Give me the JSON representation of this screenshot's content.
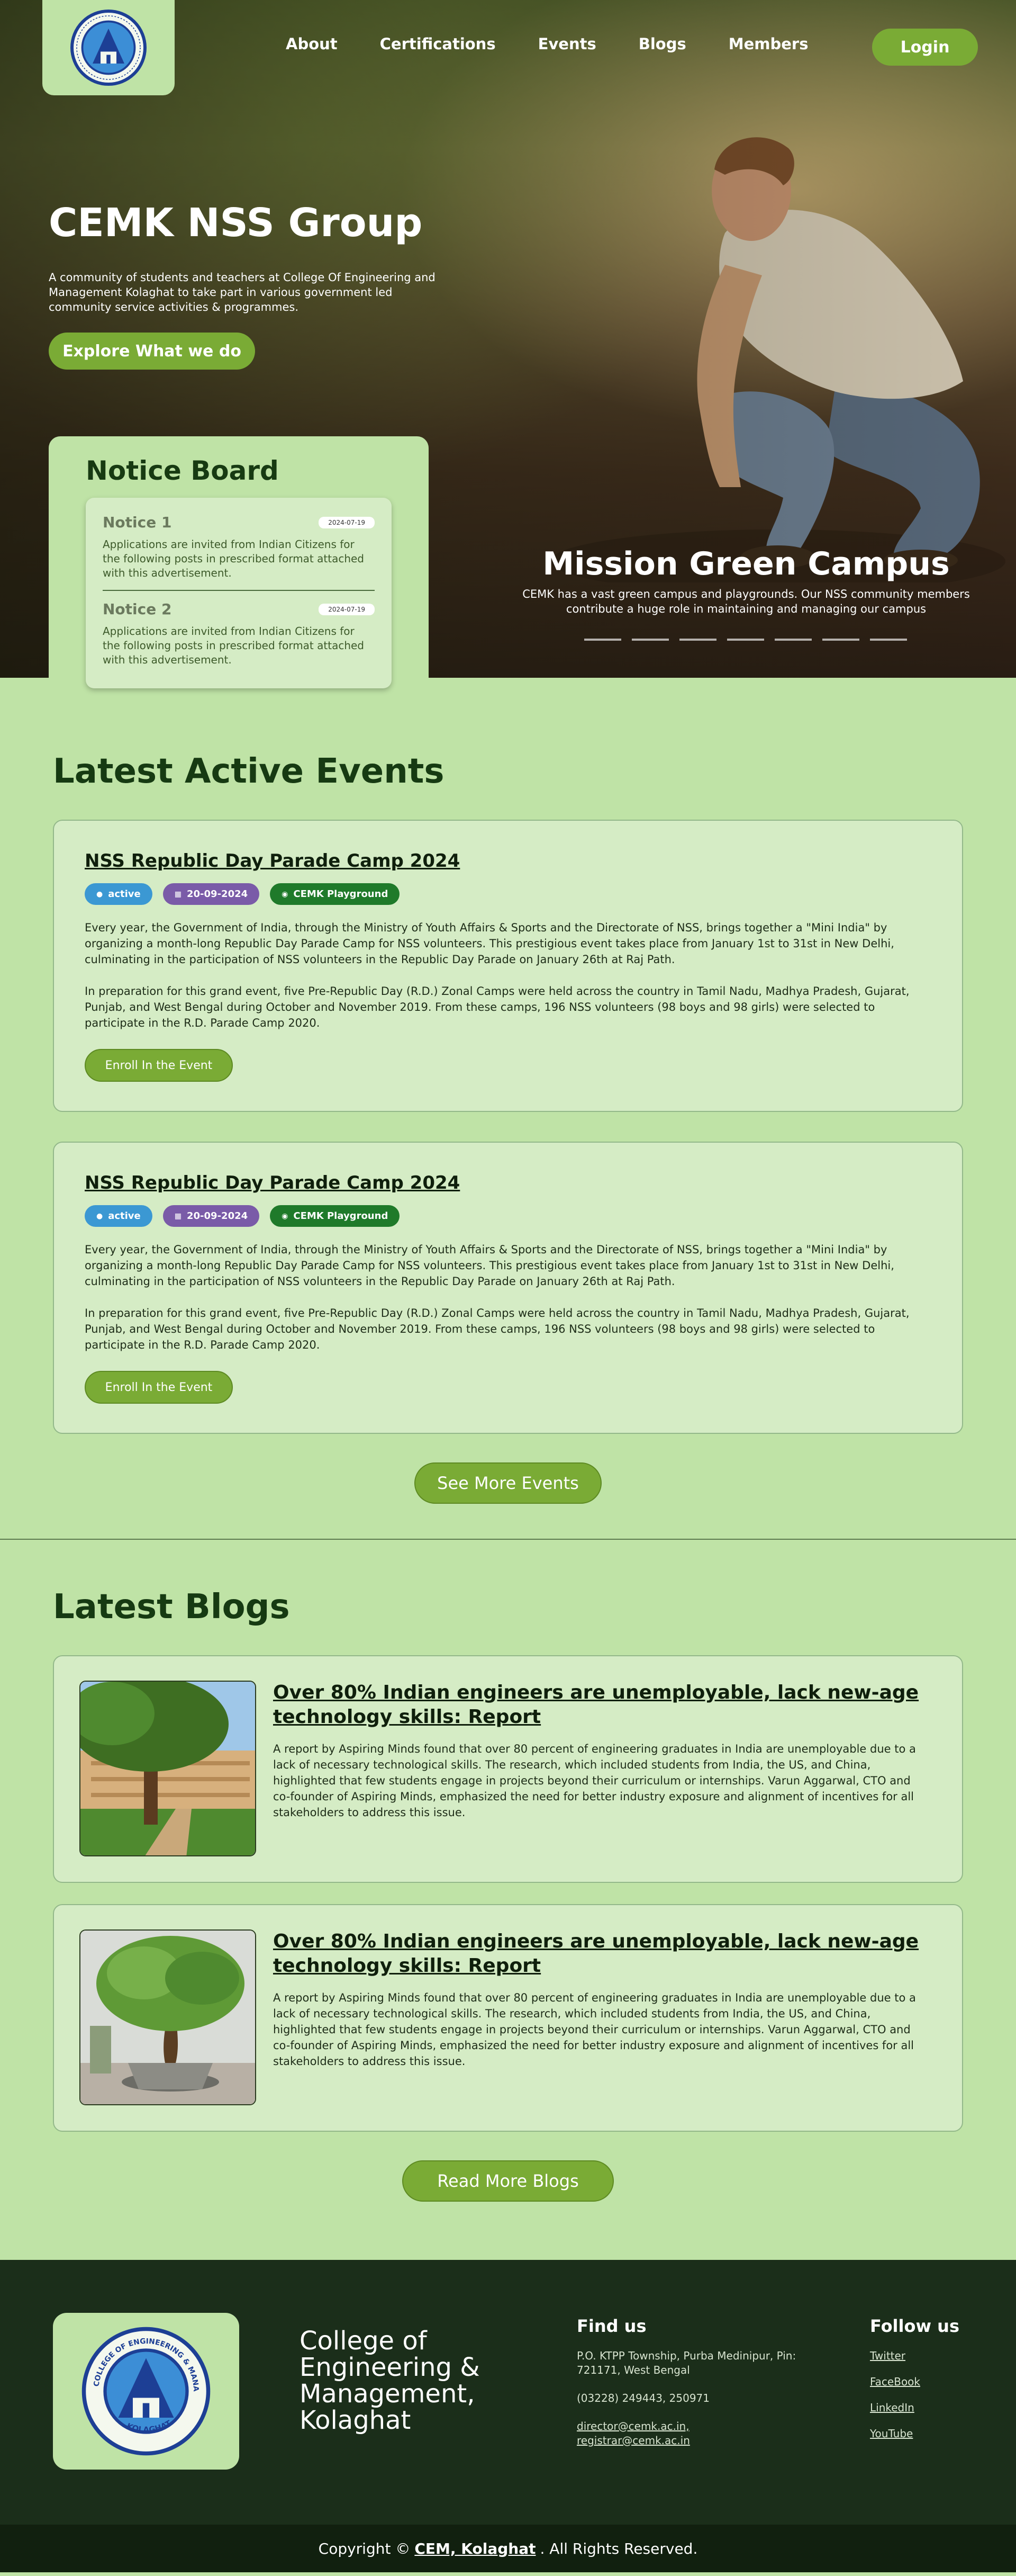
{
  "nav": {
    "items": [
      "About",
      "Certifications",
      "Events",
      "Blogs",
      "Members"
    ],
    "login_label": "Login"
  },
  "hero": {
    "title": "CEMK NSS Group",
    "description": "A community of students and teachers at College Of Engineering and Management Kolaghat to take part in various government led community service activities & programmes.",
    "cta_label": "Explore What we do",
    "slide_title": "Mission Green Campus",
    "slide_text": "CEMK has a vast green campus and playgrounds. Our NSS community members contribute a huge role in maintaining and managing our campus"
  },
  "notice_board": {
    "title": "Notice Board",
    "items": [
      {
        "name": "Notice 1",
        "date": "2024-07-19",
        "text": "Applications are invited from Indian Citizens for the following posts in prescribed format attached with this advertisement."
      },
      {
        "name": "Notice 2",
        "date": "2024-07-19",
        "text": "Applications are invited from Indian Citizens for the following posts in prescribed format attached with this advertisement."
      }
    ]
  },
  "events": {
    "title": "Latest Active Events",
    "items": [
      {
        "title": "NSS Republic Day Parade Camp 2024",
        "status": "active",
        "date": "20-09-2024",
        "place": "CEMK Playground",
        "para1": "Every year, the Government of India, through the Ministry of Youth Affairs & Sports and the Directorate of NSS, brings together a \"Mini India\" by organizing a month-long Republic Day Parade Camp for NSS volunteers. This prestigious event takes place from January 1st to 31st in New Delhi, culminating in the participation of NSS volunteers in the Republic Day Parade on January 26th at Raj Path.",
        "para2": "In preparation for this grand event, five Pre-Republic Day (R.D.) Zonal Camps were held across the country in Tamil Nadu, Madhya Pradesh, Gujarat, Punjab, and West Bengal during October and November 2019. From these camps, 196 NSS volunteers (98 boys and 98 girls) were selected to participate in the R.D. Parade Camp 2020.",
        "button": "Enroll In the Event"
      },
      {
        "title": "NSS Republic Day Parade Camp 2024",
        "status": "active",
        "date": "20-09-2024",
        "place": "CEMK Playground",
        "para1": "Every year, the Government of India, through the Ministry of Youth Affairs & Sports and the Directorate of NSS, brings together a \"Mini India\" by organizing a month-long Republic Day Parade Camp for NSS volunteers. This prestigious event takes place from January 1st to 31st in New Delhi, culminating in the participation of NSS volunteers in the Republic Day Parade on January 26th at Raj Path.",
        "para2": "In preparation for this grand event, five Pre-Republic Day (R.D.) Zonal Camps were held across the country in Tamil Nadu, Madhya Pradesh, Gujarat, Punjab, and West Bengal during October and November 2019. From these camps, 196 NSS volunteers (98 boys and 98 girls) were selected to participate in the R.D. Parade Camp 2020.",
        "button": "Enroll In the Event"
      }
    ],
    "see_more_label": "See More Events"
  },
  "blogs": {
    "title": "Latest Blogs",
    "items": [
      {
        "title": "Over 80% Indian engineers are unemployable, lack new-age technology skills: Report",
        "text": "A report by Aspiring Minds found that over 80 percent of engineering graduates in India are unemployable due to a lack of necessary technological skills. The research, which included students from India, the US, and China, highlighted that few students engage in projects beyond their curriculum or internships. Varun Aggarwal, CTO and co-founder of Aspiring Minds, emphasized the need for better industry exposure and alignment of incentives for all stakeholders to address this issue.",
        "image_icon": "campus-photo"
      },
      {
        "title": "Over 80% Indian engineers are unemployable, lack new-age technology skills: Report",
        "text": "A report by Aspiring Minds found that over 80 percent of engineering graduates in India are unemployable due to a lack of necessary technological skills. The research, which included students from India, the US, and China, highlighted that few students engage in projects beyond their curriculum or internships. Varun Aggarwal, CTO and co-founder of Aspiring Minds, emphasized the need for better industry exposure and alignment of incentives for all stakeholders to address this issue.",
        "image_icon": "tree-photo"
      }
    ],
    "read_more_label": "Read More Blogs"
  },
  "footer": {
    "college_name": "College of Engineering & Management, Kolaghat",
    "find_us_title": "Find us",
    "address": "P.O. KTPP Township, Purba Medinipur, Pin: 721171, West Bengal",
    "phone": "(03228) 249443, 250971",
    "email1": "director@cemk.ac.in,",
    "email2": "registrar@cemk.ac.in",
    "follow_title": "Follow us",
    "socials": [
      "Twitter",
      "FaceBook",
      "LinkedIn",
      "YouTube"
    ],
    "copyright_prefix": "Copyright ©",
    "copyright_link": "CEM, Kolaghat",
    "copyright_suffix": ". All Rights Reserved.",
    "logo_text_top": "COLLEGE OF ENGINEERING & MANAGEMENT",
    "logo_text_bottom": "KOLAGHAT"
  },
  "colors": {
    "page_bg": "#bfe3a6",
    "card_bg": "#d5ecc5",
    "accent_button": "#7aab35",
    "footer_bg": "#1b2e1a",
    "status_active": "#3b98d3",
    "date_tag": "#7a5ba8",
    "place_tag": "#1f7a2a"
  }
}
